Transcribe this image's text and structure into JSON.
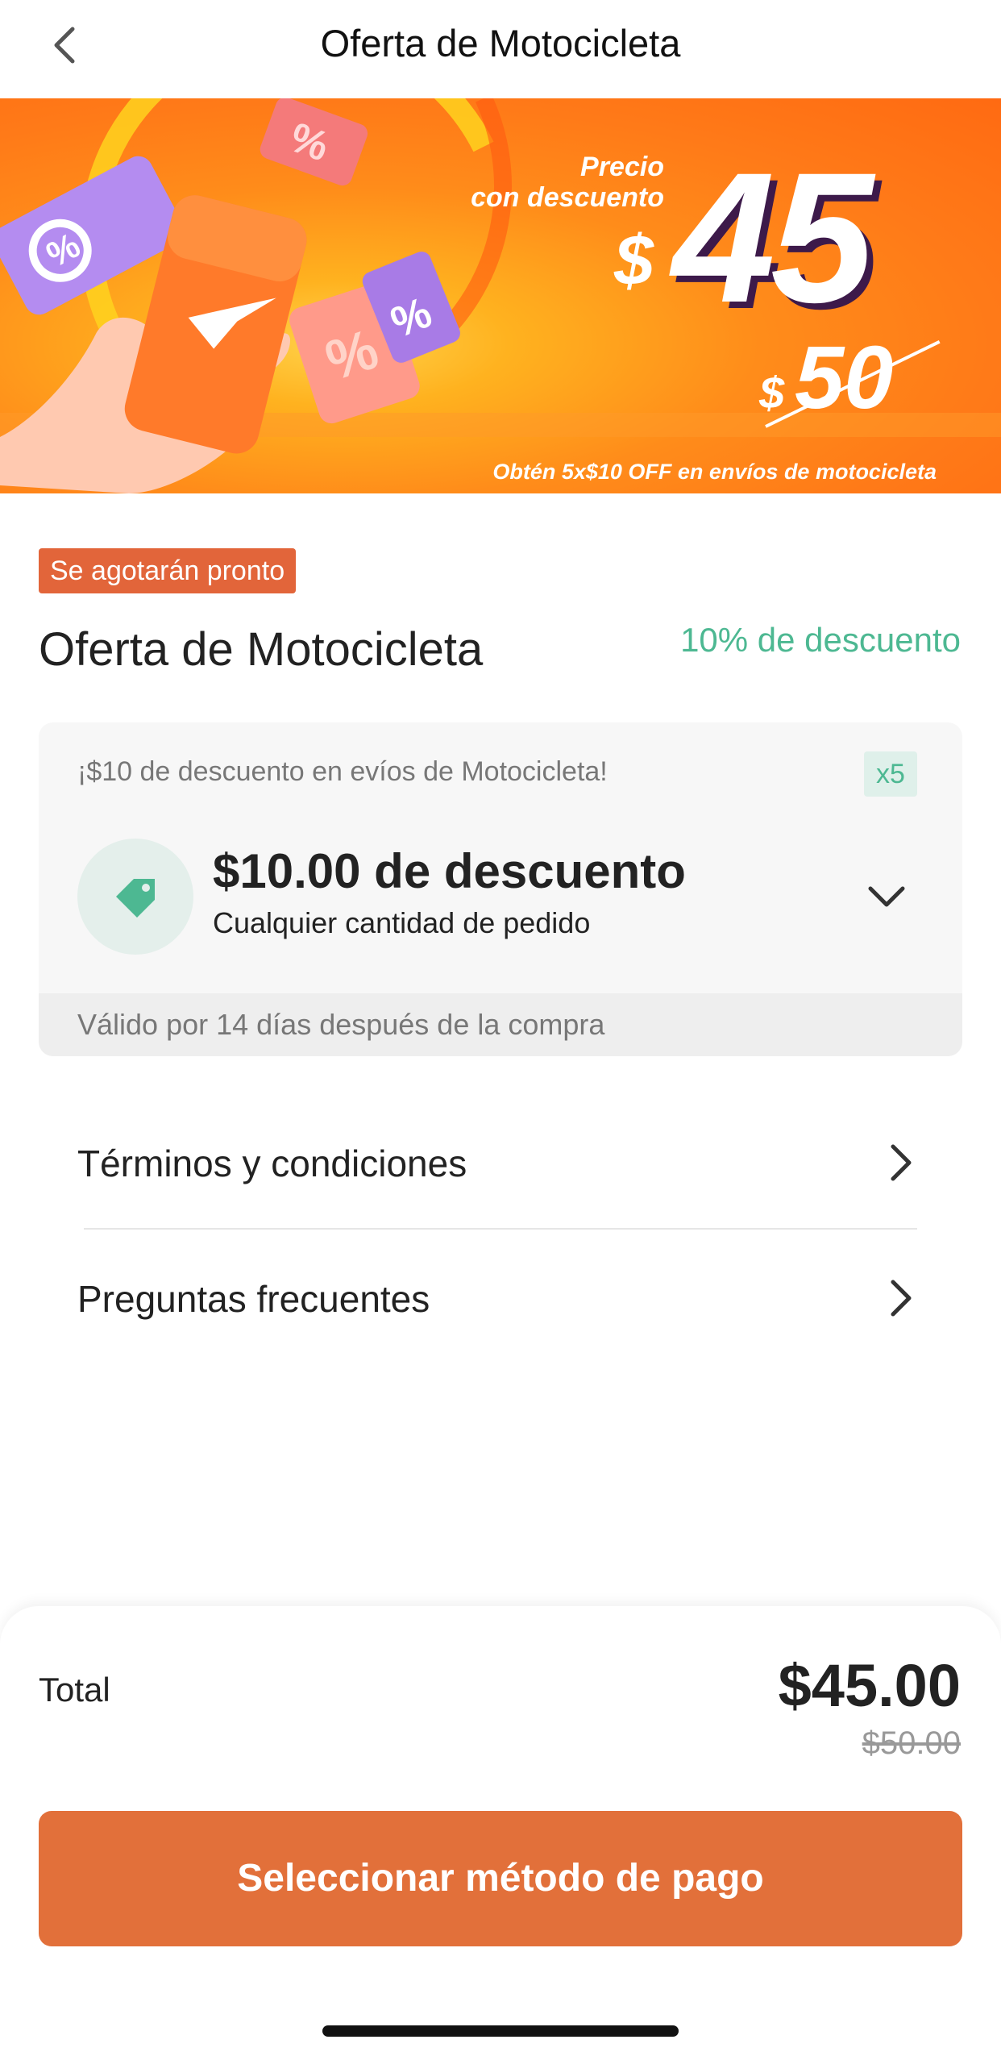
{
  "header": {
    "title": "Oferta de Motocicleta",
    "back_icon": "chevron-left-icon"
  },
  "banner": {
    "promo_label_line1": "Precio",
    "promo_label_line2": "con descuento",
    "currency": "$",
    "price": "45",
    "old_currency": "$",
    "old_price": "50",
    "footer": "Obtén 5x$10 OFF en envíos de motocicleta"
  },
  "offer": {
    "badge": "Se agotarán pronto",
    "title": "Oferta de Motocicleta",
    "discount_percent": "10% de descuento"
  },
  "coupon": {
    "description": "¡$10 de descuento en evíos de Motocicleta!",
    "quantity": "x5",
    "icon": "tag-icon",
    "amount": "$10.00 de descuento",
    "condition": "Cualquier cantidad de pedido",
    "validity": "Válido por 14 días después de la compra"
  },
  "links": [
    {
      "label": "Términos y condiciones"
    },
    {
      "label": "Preguntas frecuentes"
    }
  ],
  "footer": {
    "total_label": "Total",
    "total_price": "$45.00",
    "original_price": "$50.00",
    "pay_button": "Seleccionar método de pago"
  },
  "colors": {
    "accent": "#e2703a",
    "badge": "#e2653a",
    "discount_green": "#4db892"
  }
}
